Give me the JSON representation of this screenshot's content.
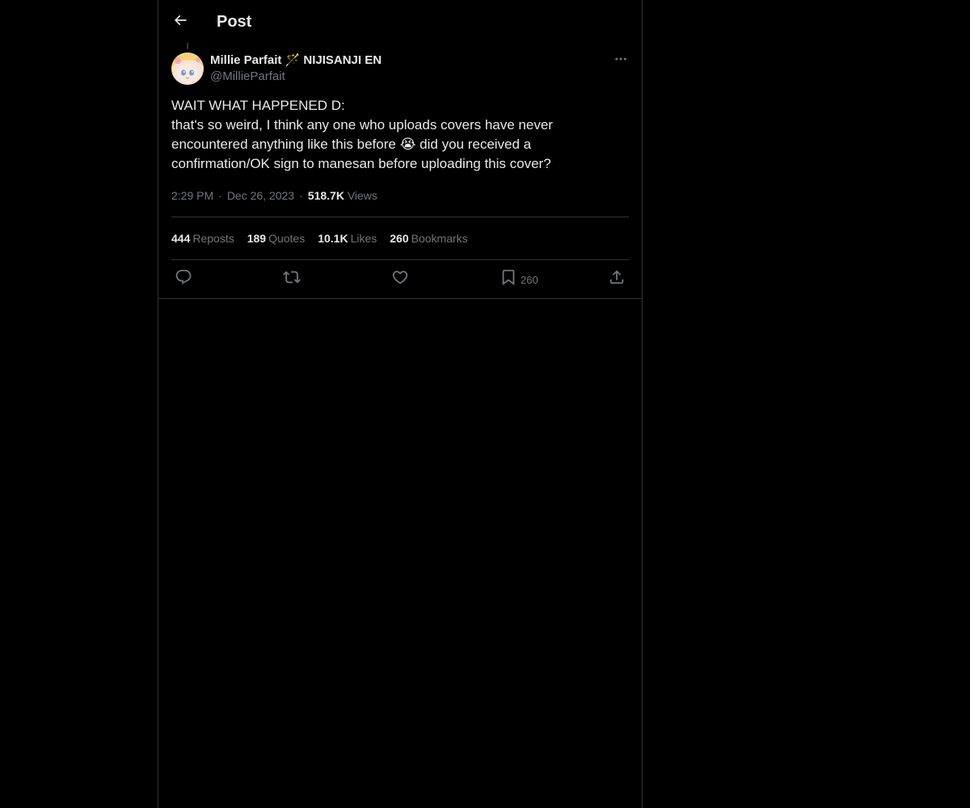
{
  "header": {
    "title": "Post",
    "back_icon": "arrow-left-icon"
  },
  "tweet": {
    "author": {
      "display_name": "Millie Parfait 🪄 NIJISANJI EN",
      "handle": "@MillieParfait",
      "avatar": "avatar-image"
    },
    "text_lines": [
      "WAIT WHAT HAPPENED D:",
      "that's so weird, I think any one who uploads covers have never",
      "encountered anything like this before 😭 did you received a",
      "confirmation/OK sign to manesan before uploading this cover?"
    ],
    "time": "2:29 PM",
    "date": "Dec 26, 2023",
    "views_count": "518.7K",
    "views_label": "Views",
    "separator": "·"
  },
  "stats": {
    "reposts": {
      "count": "444",
      "label": "Reposts"
    },
    "quotes": {
      "count": "189",
      "label": "Quotes"
    },
    "likes": {
      "count": "10.1K",
      "label": "Likes"
    },
    "bookmarks": {
      "count": "260",
      "label": "Bookmarks"
    }
  },
  "actions": {
    "reply_icon": "reply-icon",
    "repost_icon": "repost-icon",
    "like_icon": "heart-icon",
    "bookmark_icon": "bookmark-icon",
    "bookmark_count": "260",
    "share_icon": "share-icon"
  },
  "colors": {
    "background": "#000000",
    "text_primary": "#e7e9ea",
    "text_secondary": "#71767b",
    "border": "#2f3336"
  }
}
